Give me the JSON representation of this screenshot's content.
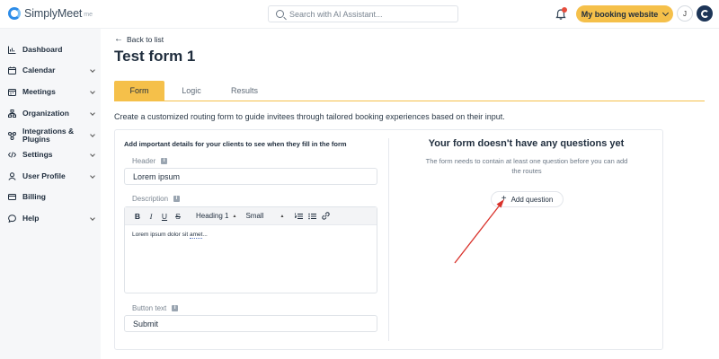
{
  "app": {
    "logo_text": "SimplyMeet",
    "logo_sub": "me"
  },
  "header": {
    "search_placeholder": "Search with AI Assistant...",
    "booking_button": "My booking website",
    "avatar_initial": "J"
  },
  "sidebar": {
    "items": [
      {
        "label": "Dashboard",
        "icon": "chart-icon",
        "has_chevron": false
      },
      {
        "label": "Calendar",
        "icon": "calendar-icon",
        "has_chevron": true
      },
      {
        "label": "Meetings",
        "icon": "meetings-icon",
        "has_chevron": true
      },
      {
        "label": "Organization",
        "icon": "organization-icon",
        "has_chevron": true
      },
      {
        "label": "Integrations & Plugins",
        "icon": "integrations-icon",
        "has_chevron": true
      },
      {
        "label": "Settings",
        "icon": "code-icon",
        "has_chevron": true
      },
      {
        "label": "User Profile",
        "icon": "user-icon",
        "has_chevron": true
      },
      {
        "label": "Billing",
        "icon": "billing-icon",
        "has_chevron": false
      },
      {
        "label": "Help",
        "icon": "help-icon",
        "has_chevron": true
      }
    ]
  },
  "main": {
    "back_link": "Back to list",
    "title": "Test form 1",
    "tabs": [
      {
        "label": "Form",
        "active": true
      },
      {
        "label": "Logic",
        "active": false
      },
      {
        "label": "Results",
        "active": false
      }
    ],
    "intro": "Create a customized routing form to guide invitees through tailored booking experiences based on their input.",
    "form": {
      "section_title": "Add important details for your clients to see when they fill in the form",
      "header_label": "Header",
      "header_value": "Lorem ipsum",
      "description_label": "Description",
      "toolbar": {
        "bold": "B",
        "italic": "I",
        "underline": "U",
        "strike": "S",
        "heading": "Heading 1",
        "size": "Small"
      },
      "description_text_a": "Lorem ipsum dolor sit ",
      "description_text_b": "amet",
      "description_text_c": "...",
      "button_text_label": "Button text",
      "button_text_value": "Submit"
    },
    "empty_state": {
      "title": "Your form doesn't have any questions yet",
      "subtitle": "The form needs to contain at least one question before you can add the routes",
      "add_button": "Add question"
    }
  },
  "colors": {
    "accent": "#f5c04a",
    "brand": "#2d8ce8",
    "annotation_arrow": "#d9322b"
  }
}
